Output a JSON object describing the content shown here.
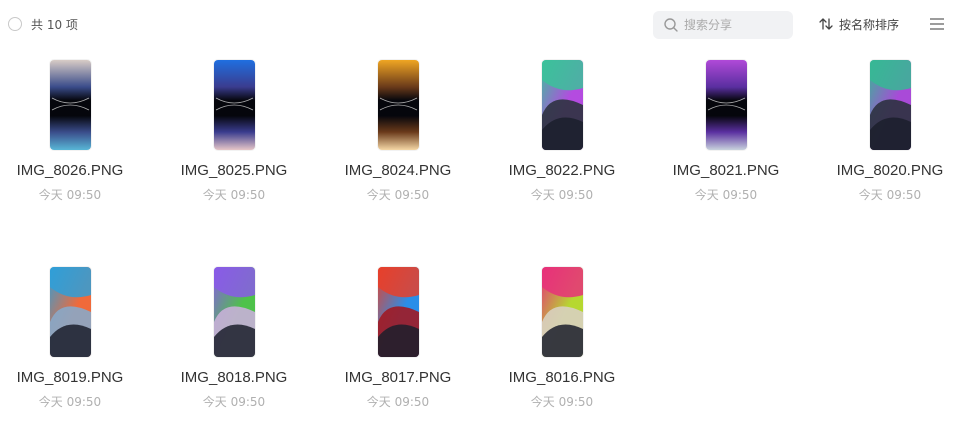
{
  "header": {
    "count_label": "共 10 项",
    "search_placeholder": "搜索分享",
    "sort_label": "按名称排序"
  },
  "files": [
    {
      "name": "IMG_8026.PNG",
      "date": "今天 09:50",
      "style": "aurora",
      "colors": [
        "#d8ccc6",
        "#3a4c8a",
        "#58b6d6"
      ]
    },
    {
      "name": "IMG_8025.PNG",
      "date": "今天 09:50",
      "style": "aurora",
      "colors": [
        "#1f6fe0",
        "#3a3c8e",
        "#e6c6c8"
      ]
    },
    {
      "name": "IMG_8024.PNG",
      "date": "今天 09:50",
      "style": "aurora",
      "colors": [
        "#f0a623",
        "#6a3a1a",
        "#f5d7a6"
      ]
    },
    {
      "name": "IMG_8022.PNG",
      "date": "今天 09:50",
      "style": "wave",
      "colors": [
        "#3bc29a",
        "#b44be0",
        "#2e3340"
      ]
    },
    {
      "name": "IMG_8021.PNG",
      "date": "今天 09:50",
      "style": "aurora",
      "colors": [
        "#b04ad8",
        "#5a2fa0",
        "#c8d2dd"
      ]
    },
    {
      "name": "IMG_8020.PNG",
      "date": "今天 09:50",
      "style": "wave",
      "colors": [
        "#36b894",
        "#a94ad8",
        "#2c3240"
      ]
    },
    {
      "name": "IMG_8019.PNG",
      "date": "今天 09:50",
      "style": "wave",
      "colors": [
        "#2f9fd8",
        "#f06a3a",
        "#8aa8c8"
      ]
    },
    {
      "name": "IMG_8018.PNG",
      "date": "今天 09:50",
      "style": "wave",
      "colors": [
        "#8a5ae8",
        "#4ec24a",
        "#c8b0d8"
      ]
    },
    {
      "name": "IMG_8017.PNG",
      "date": "今天 09:50",
      "style": "wave",
      "colors": [
        "#e8402a",
        "#2a8ee8",
        "#a01a24"
      ]
    },
    {
      "name": "IMG_8016.PNG",
      "date": "今天 09:50",
      "style": "wave",
      "colors": [
        "#e8307a",
        "#b6d830",
        "#d8d0c0"
      ]
    }
  ]
}
